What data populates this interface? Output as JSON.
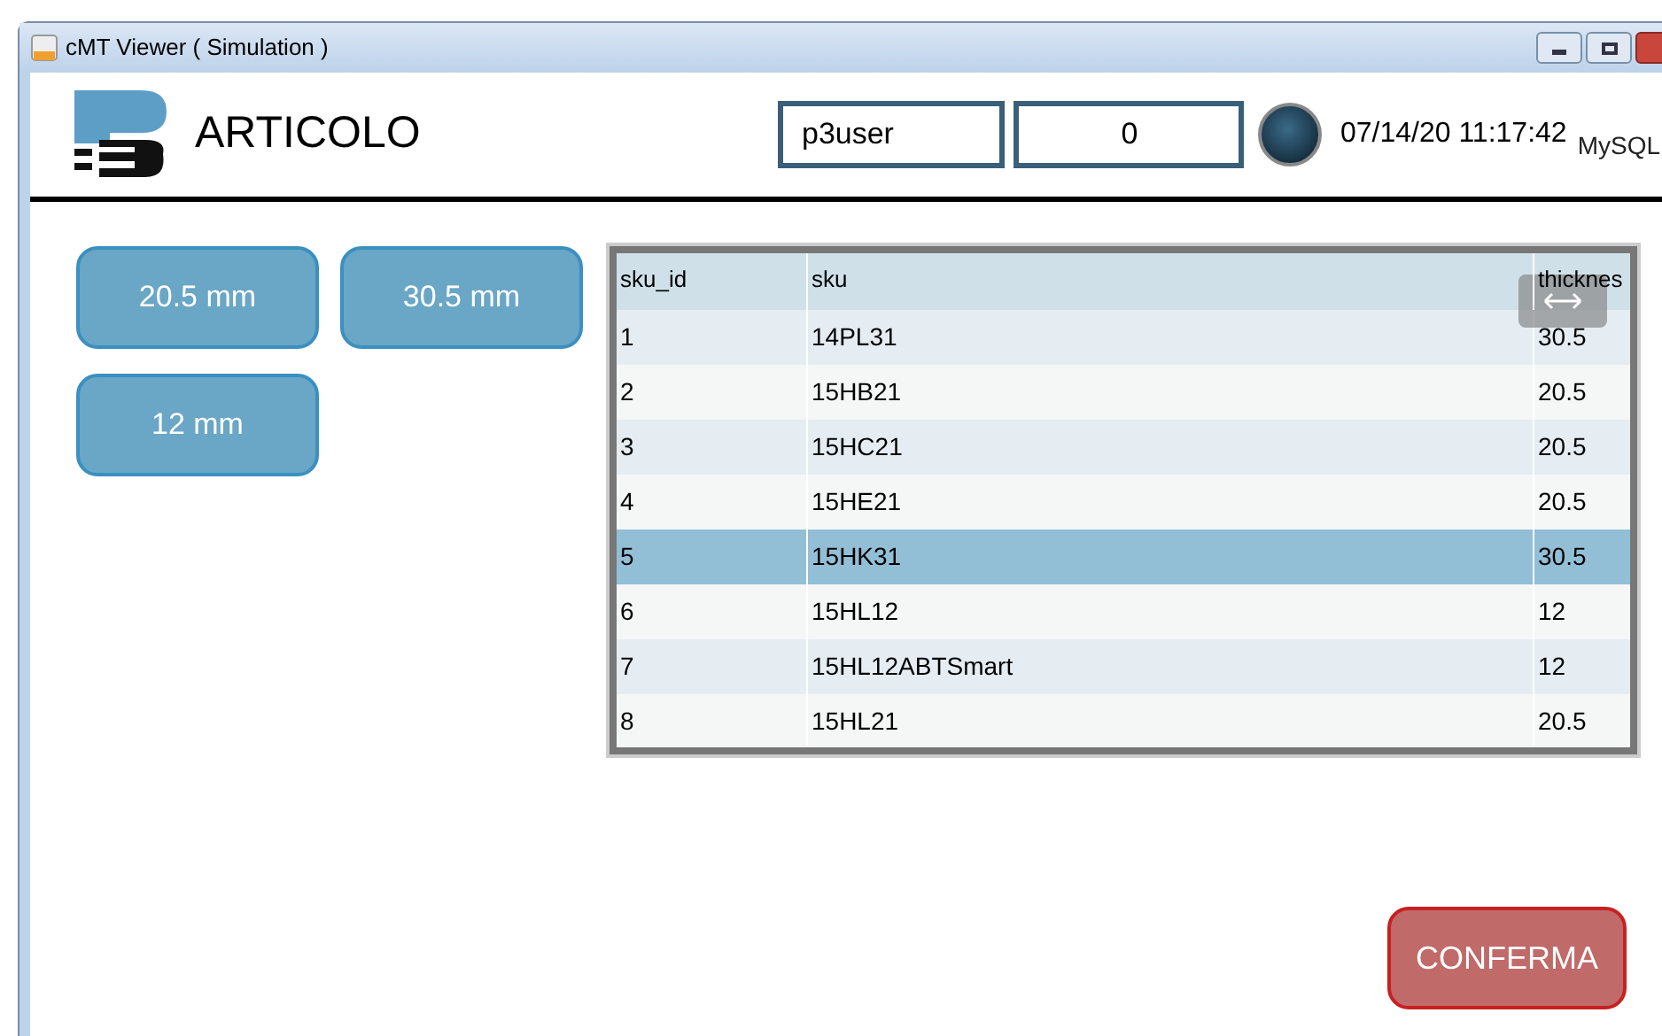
{
  "window": {
    "title": "cMT Viewer ( Simulation )"
  },
  "header": {
    "title": "ARTICOLO",
    "user": "p3user",
    "counter": "0",
    "datetime": "07/14/20 11:17:42",
    "db_logo": "MySQL"
  },
  "filters": [
    {
      "label": "20.5 mm"
    },
    {
      "label": "30.5 mm"
    },
    {
      "label": "12 mm"
    }
  ],
  "table": {
    "columns": [
      "sku_id",
      "sku",
      "thicknes"
    ],
    "rows": [
      {
        "cells": [
          "1",
          "14PL31",
          "30.5"
        ],
        "selected": false
      },
      {
        "cells": [
          "2",
          "15HB21",
          "20.5"
        ],
        "selected": false
      },
      {
        "cells": [
          "3",
          "15HC21",
          "20.5"
        ],
        "selected": false
      },
      {
        "cells": [
          "4",
          "15HE21",
          "20.5"
        ],
        "selected": false
      },
      {
        "cells": [
          "5",
          "15HK31",
          "30.5"
        ],
        "selected": true
      },
      {
        "cells": [
          "6",
          "15HL12",
          "12"
        ],
        "selected": false
      },
      {
        "cells": [
          "7",
          "15HL12ABTSmart",
          "12"
        ],
        "selected": false
      },
      {
        "cells": [
          "8",
          "15HL21",
          "20.5"
        ],
        "selected": false
      }
    ]
  },
  "confirm_button": "CONFERMA"
}
